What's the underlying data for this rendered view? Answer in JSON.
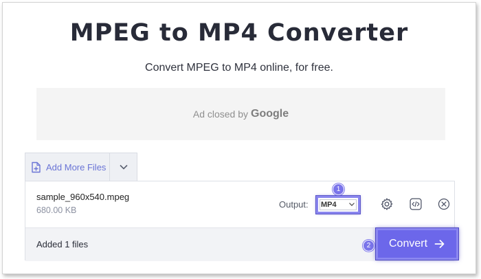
{
  "header": {
    "title": "MPEG to MP4 Converter",
    "subtitle": "Convert MPEG to MP4 online, for free."
  },
  "ad": {
    "closed_text": "Ad closed by",
    "brand": "Google"
  },
  "toolbar": {
    "add_more_label": "Add More Files"
  },
  "file": {
    "name": "sample_960x540.mpeg",
    "size": "680.00 KB",
    "output_label": "Output:",
    "output_value": "MP4"
  },
  "footer": {
    "added_text": "Added 1 files",
    "convert_label": "Convert"
  },
  "annotations": {
    "step1": "1",
    "step2": "2"
  },
  "colors": {
    "accent": "#6c67ea",
    "highlight": "#8a86ee",
    "link": "#6a74d6"
  },
  "icons": [
    "file-plus-icon",
    "chevron-down-icon",
    "gear-icon",
    "code-icon",
    "close-circle-icon",
    "arrow-right-icon"
  ]
}
